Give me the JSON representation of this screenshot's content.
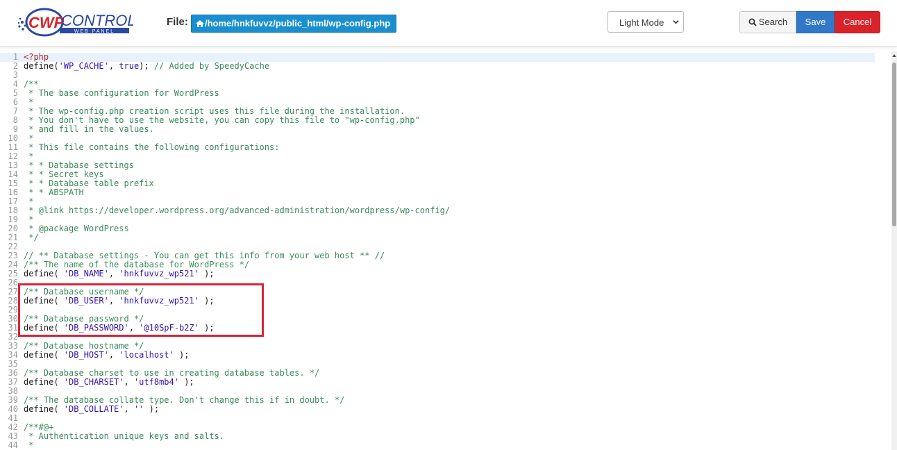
{
  "header": {
    "logo_text": "CWPCONTROL",
    "logo_sub": "WEB PANEL",
    "file_label": "File:",
    "file_path": "/home/hnkfuvvz/public_html/wp-config.php",
    "mode_select": "Light Mode",
    "search_label": "Search",
    "save_label": "Save",
    "cancel_label": "Cancel"
  },
  "colors": {
    "path_badge": "#1a8fcf",
    "save": "#3278c8",
    "cancel": "#d9222a",
    "highlight_box": "#d8233a"
  },
  "editor": {
    "lines": [
      "<?php",
      "define('WP_CACHE', true); // Added by SpeedyCache",
      "",
      "/**",
      " * The base configuration for WordPress",
      " *",
      " * The wp-config.php creation script uses this file during the installation.",
      " * You don't have to use the website, you can copy this file to \"wp-config.php\"",
      " * and fill in the values.",
      " *",
      " * This file contains the following configurations:",
      " *",
      " * * Database settings",
      " * * Secret keys",
      " * * Database table prefix",
      " * * ABSPATH",
      " *",
      " * @link https://developer.wordpress.org/advanced-administration/wordpress/wp-config/",
      " *",
      " * @package WordPress",
      " */",
      "",
      "// ** Database settings - You can get this info from your web host ** //",
      "/** The name of the database for WordPress */",
      "define( 'DB_NAME', 'hnkfuvvz_wp521' );",
      "",
      "/** Database username */",
      "define( 'DB_USER', 'hnkfuvvz_wp521' );",
      "",
      "/** Database password */",
      "define( 'DB_PASSWORD', '@10SpF-b2Z' );",
      "",
      "/** Database hostname */",
      "define( 'DB_HOST', 'localhost' );",
      "",
      "/** Database charset to use in creating database tables. */",
      "define( 'DB_CHARSET', 'utf8mb4' );",
      "",
      "/** The database collate type. Don't change this if in doubt. */",
      "define( 'DB_COLLATE', '' );",
      "",
      "/**#@+",
      " * Authentication unique keys and salts.",
      " *"
    ]
  }
}
